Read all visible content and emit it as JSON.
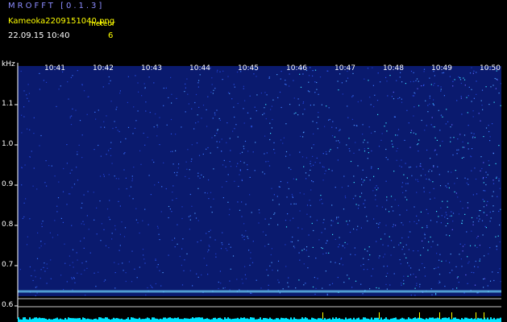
{
  "app": {
    "title": "MROFFT [0.1.3]"
  },
  "file": {
    "name": "Kameoka2209151040.png",
    "detect_label": "meteor"
  },
  "session": {
    "datetime": "22.09.15 10:40",
    "count": "6"
  },
  "colors": {
    "background": "#000000",
    "title": "#8c8cff",
    "header": "#ffff00",
    "text": "#ffffff",
    "signal": "#00e5ff",
    "spectrogram": "#0a1a6e"
  },
  "chart_data": {
    "type": "heatmap",
    "title": "",
    "y_unit": "kHz",
    "y_ticks": [
      "1.1",
      "1.0",
      "0.9",
      "0.8",
      "0.7",
      "0.6"
    ],
    "x_ticks": [
      "10:41",
      "10:42",
      "10:43",
      "10:44",
      "10:45",
      "10:46",
      "10:47",
      "10:48",
      "10:49",
      "10:50"
    ],
    "ylim": [
      0.6,
      1.15
    ],
    "carrier_khz": 0.64,
    "grid": false
  }
}
